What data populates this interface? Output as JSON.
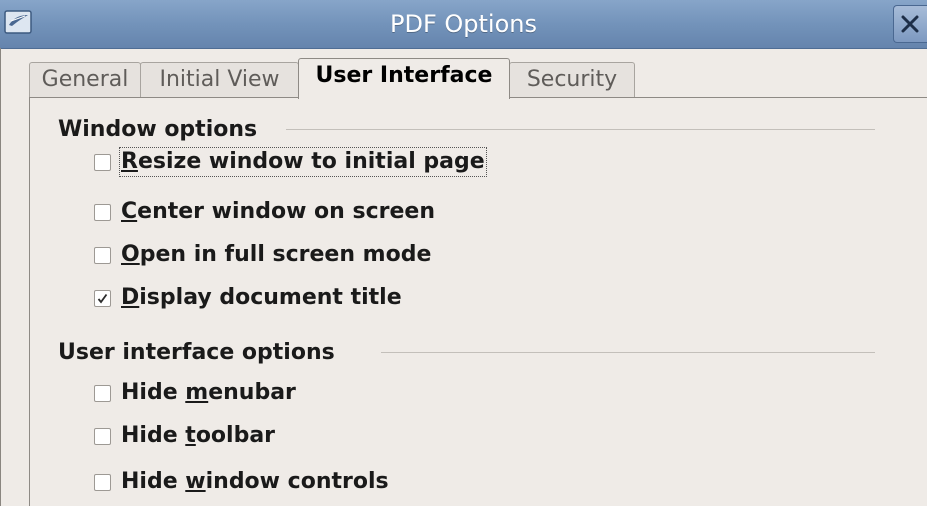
{
  "window": {
    "title": "PDF Options",
    "icon": "app-feather-icon",
    "close_icon": "close-icon"
  },
  "tabs": [
    {
      "label": "General",
      "active": false
    },
    {
      "label": "Initial View",
      "active": false
    },
    {
      "label": "User Interface",
      "active": true
    },
    {
      "label": "Security",
      "active": false
    }
  ],
  "window_options": {
    "title": "Window options",
    "items": [
      {
        "pre": "",
        "mnemonic": "R",
        "post": "esize window to initial page",
        "checked": false,
        "focused": true
      },
      {
        "pre": "",
        "mnemonic": "C",
        "post": "enter window on screen",
        "checked": false,
        "focused": false
      },
      {
        "pre": "",
        "mnemonic": "O",
        "post": "pen in full screen mode",
        "checked": false,
        "focused": false
      },
      {
        "pre": "",
        "mnemonic": "D",
        "post": "isplay document title",
        "checked": true,
        "focused": false
      }
    ]
  },
  "ui_options": {
    "title": "User interface options",
    "items": [
      {
        "pre": "Hide ",
        "mnemonic": "m",
        "post": "enubar",
        "checked": false,
        "focused": false
      },
      {
        "pre": "Hide ",
        "mnemonic": "t",
        "post": "oolbar",
        "checked": false,
        "focused": false
      },
      {
        "pre": "Hide ",
        "mnemonic": "w",
        "post": "indow controls",
        "checked": false,
        "focused": false
      }
    ]
  },
  "colors": {
    "titlebar": "#7393ba",
    "background": "#efebe7"
  }
}
